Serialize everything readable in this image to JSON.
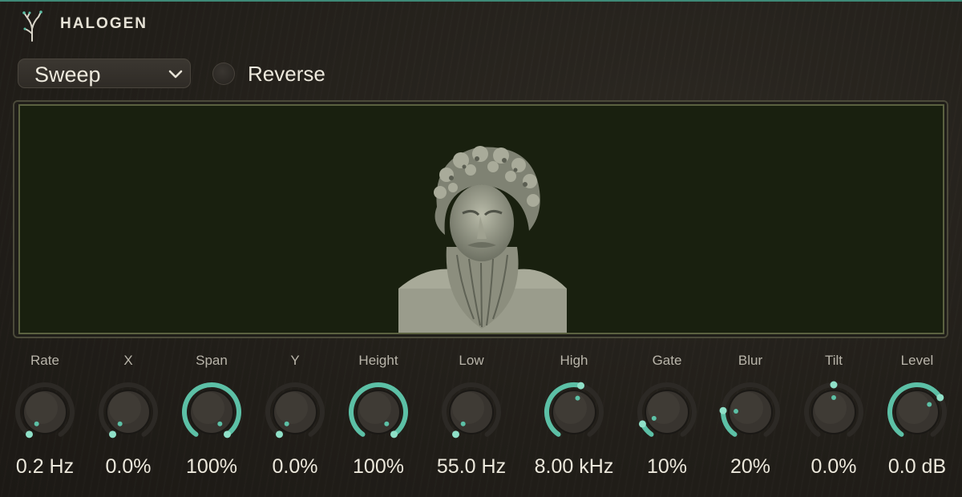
{
  "brand": {
    "name": "HALOGEN",
    "logo_icon": "tree-branch-icon"
  },
  "preset": {
    "value": "Sweep",
    "icon": "chevron-down-icon"
  },
  "reverse": {
    "label": "Reverse",
    "checked": false
  },
  "display": {
    "image": "statue-bust"
  },
  "colors": {
    "accent": "#5cc0a6",
    "track": "#2c2925",
    "knob_body": "#38342f",
    "display_bg": "#19200f"
  },
  "knobs": [
    {
      "id": "rate",
      "label": "Rate",
      "value": "0.2 Hz",
      "level": 0.0,
      "bipolar": false
    },
    {
      "id": "x",
      "label": "X",
      "value": "0.0%",
      "level": 0.0,
      "bipolar": false
    },
    {
      "id": "span",
      "label": "Span",
      "value": "100%",
      "level": 1.0,
      "bipolar": false
    },
    {
      "id": "y",
      "label": "Y",
      "value": "0.0%",
      "level": 0.0,
      "bipolar": false
    },
    {
      "id": "height",
      "label": "Height",
      "value": "100%",
      "level": 1.0,
      "bipolar": false
    },
    {
      "id": "low",
      "label": "Low",
      "value": "55.0 Hz",
      "level": 0.0,
      "bipolar": false
    },
    {
      "id": "high",
      "label": "High",
      "value": "8.00 kHz",
      "level": 0.55,
      "bipolar": false
    },
    {
      "id": "gate",
      "label": "Gate",
      "value": "10%",
      "level": 0.1,
      "bipolar": false
    },
    {
      "id": "blur",
      "label": "Blur",
      "value": "20%",
      "level": 0.2,
      "bipolar": false
    },
    {
      "id": "tilt",
      "label": "Tilt",
      "value": "0.0%",
      "level": 0.5,
      "bipolar": true
    },
    {
      "id": "level",
      "label": "Level",
      "value": "0.0 dB",
      "level": 0.7,
      "bipolar": false
    }
  ]
}
